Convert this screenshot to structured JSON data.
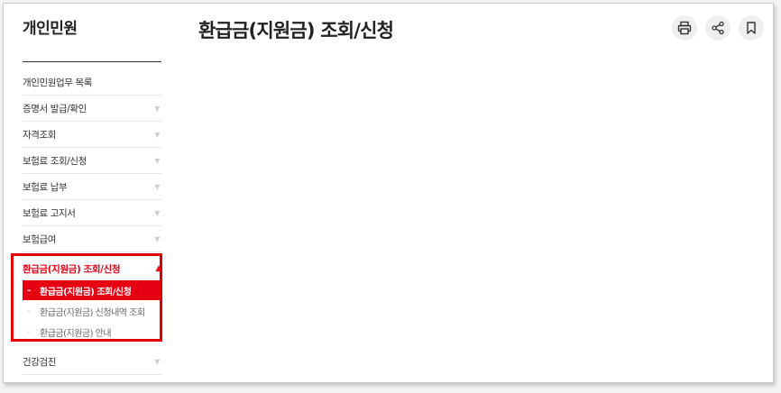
{
  "sidebar": {
    "title": "개인민원",
    "items": [
      {
        "label": "개인민원업무 목록",
        "has_arrow": false
      },
      {
        "label": "증명서 발급/확인",
        "has_arrow": true
      },
      {
        "label": "자격조회",
        "has_arrow": true
      },
      {
        "label": "보험료 조회/신청",
        "has_arrow": true
      },
      {
        "label": "보험료 납부",
        "has_arrow": true
      },
      {
        "label": "보험료 고지서",
        "has_arrow": true
      },
      {
        "label": "보험급여",
        "has_arrow": true
      }
    ],
    "active_item": {
      "label": "환급금(지원금) 조회/신청",
      "arrow": "▲",
      "sub_items": [
        {
          "label": "환급금(지원금) 조회/신청",
          "marker": "-",
          "selected": true
        },
        {
          "label": "환급금(지원금) 신청내역 조회",
          "marker": "-",
          "selected": false
        },
        {
          "label": "환급금(지원금) 안내",
          "marker": "-",
          "selected": false
        }
      ]
    },
    "after_items": [
      {
        "label": "건강검진",
        "has_arrow": true
      }
    ],
    "arrow_down": "▼"
  },
  "main": {
    "title": "환급금(지원금) 조회/신청"
  },
  "toolbar": {
    "buttons": [
      {
        "icon": "print-icon"
      },
      {
        "icon": "share-icon"
      },
      {
        "icon": "bookmark-icon"
      }
    ]
  },
  "colors": {
    "accent": "#e60012",
    "highlight_border": "#e00000"
  }
}
